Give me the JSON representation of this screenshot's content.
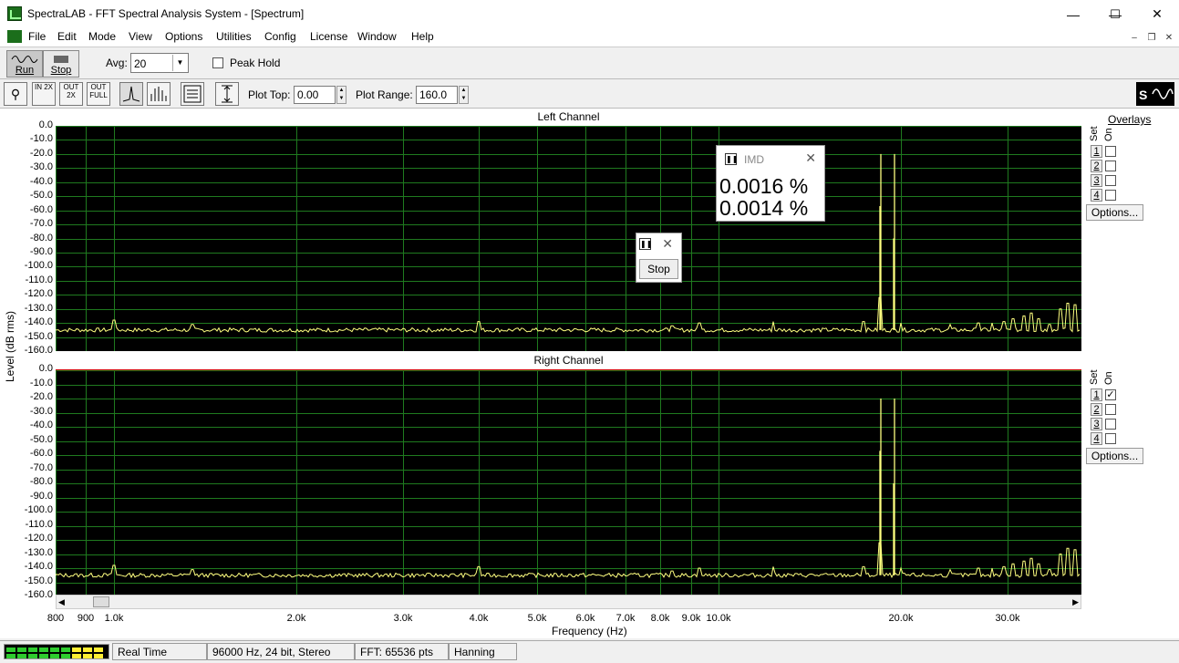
{
  "window": {
    "title": "SpectraLAB - FFT Spectral Analysis System - [Spectrum]",
    "min": "—",
    "max": "☐",
    "close": "✕"
  },
  "menu": [
    "File",
    "Edit",
    "Mode",
    "View",
    "Options",
    "Utilities",
    "Config",
    "License",
    "Window",
    "Help"
  ],
  "toolbar1": {
    "run_label": "Run",
    "stop_label": "Stop",
    "avg_label": "Avg:",
    "avg_value": "20",
    "peak_hold_label": "Peak Hold"
  },
  "toolbar2": {
    "zoom_in": "IN 2X",
    "zoom_out": "OUT 2X",
    "zoom_full": "OUT FULL",
    "plot_top_label": "Plot Top:",
    "plot_top_value": "0.00",
    "plot_range_label": "Plot Range:",
    "plot_range_value": "160.0"
  },
  "plots": {
    "y_label": "Level (dB rms)",
    "x_label": "Frequency (Hz)",
    "left_title": "Left Channel",
    "right_title": "Right Channel",
    "y_ticks": [
      "0.0",
      "-10.0",
      "-20.0",
      "-30.0",
      "-40.0",
      "-50.0",
      "-60.0",
      "-70.0",
      "-80.0",
      "-90.0",
      "-100.0",
      "-110.0",
      "-120.0",
      "-130.0",
      "-140.0",
      "-150.0",
      "-160.0"
    ],
    "x_ticks": [
      "800",
      "900",
      "1.0k",
      "2.0k",
      "3.0k",
      "4.0k",
      "5.0k",
      "6.0k",
      "7.0k",
      "8.0k",
      "9.0k",
      "10.0k",
      "20.0k",
      "30.0k"
    ],
    "grid_color": "#1f7a1f",
    "trace_color": "#ffff80"
  },
  "overlays": {
    "title": "Overlays",
    "set_label": "Set",
    "on_label": "On",
    "rows": [
      "1",
      "2",
      "3",
      "4"
    ],
    "left_checked": [
      false,
      false,
      false,
      false
    ],
    "right_checked": [
      true,
      false,
      false,
      false
    ],
    "options_label": "Options..."
  },
  "imd_popup": {
    "title": "IMD",
    "close": "✕",
    "value1": "0.0016 %",
    "value2": "0.0014 %"
  },
  "stop_popup": {
    "close": "✕",
    "stop_label": "Stop"
  },
  "status": {
    "mode": "Real Time",
    "format": "96000 Hz, 24 bit, Stereo",
    "fft": "FFT: 65536 pts",
    "window": "Hanning"
  }
}
